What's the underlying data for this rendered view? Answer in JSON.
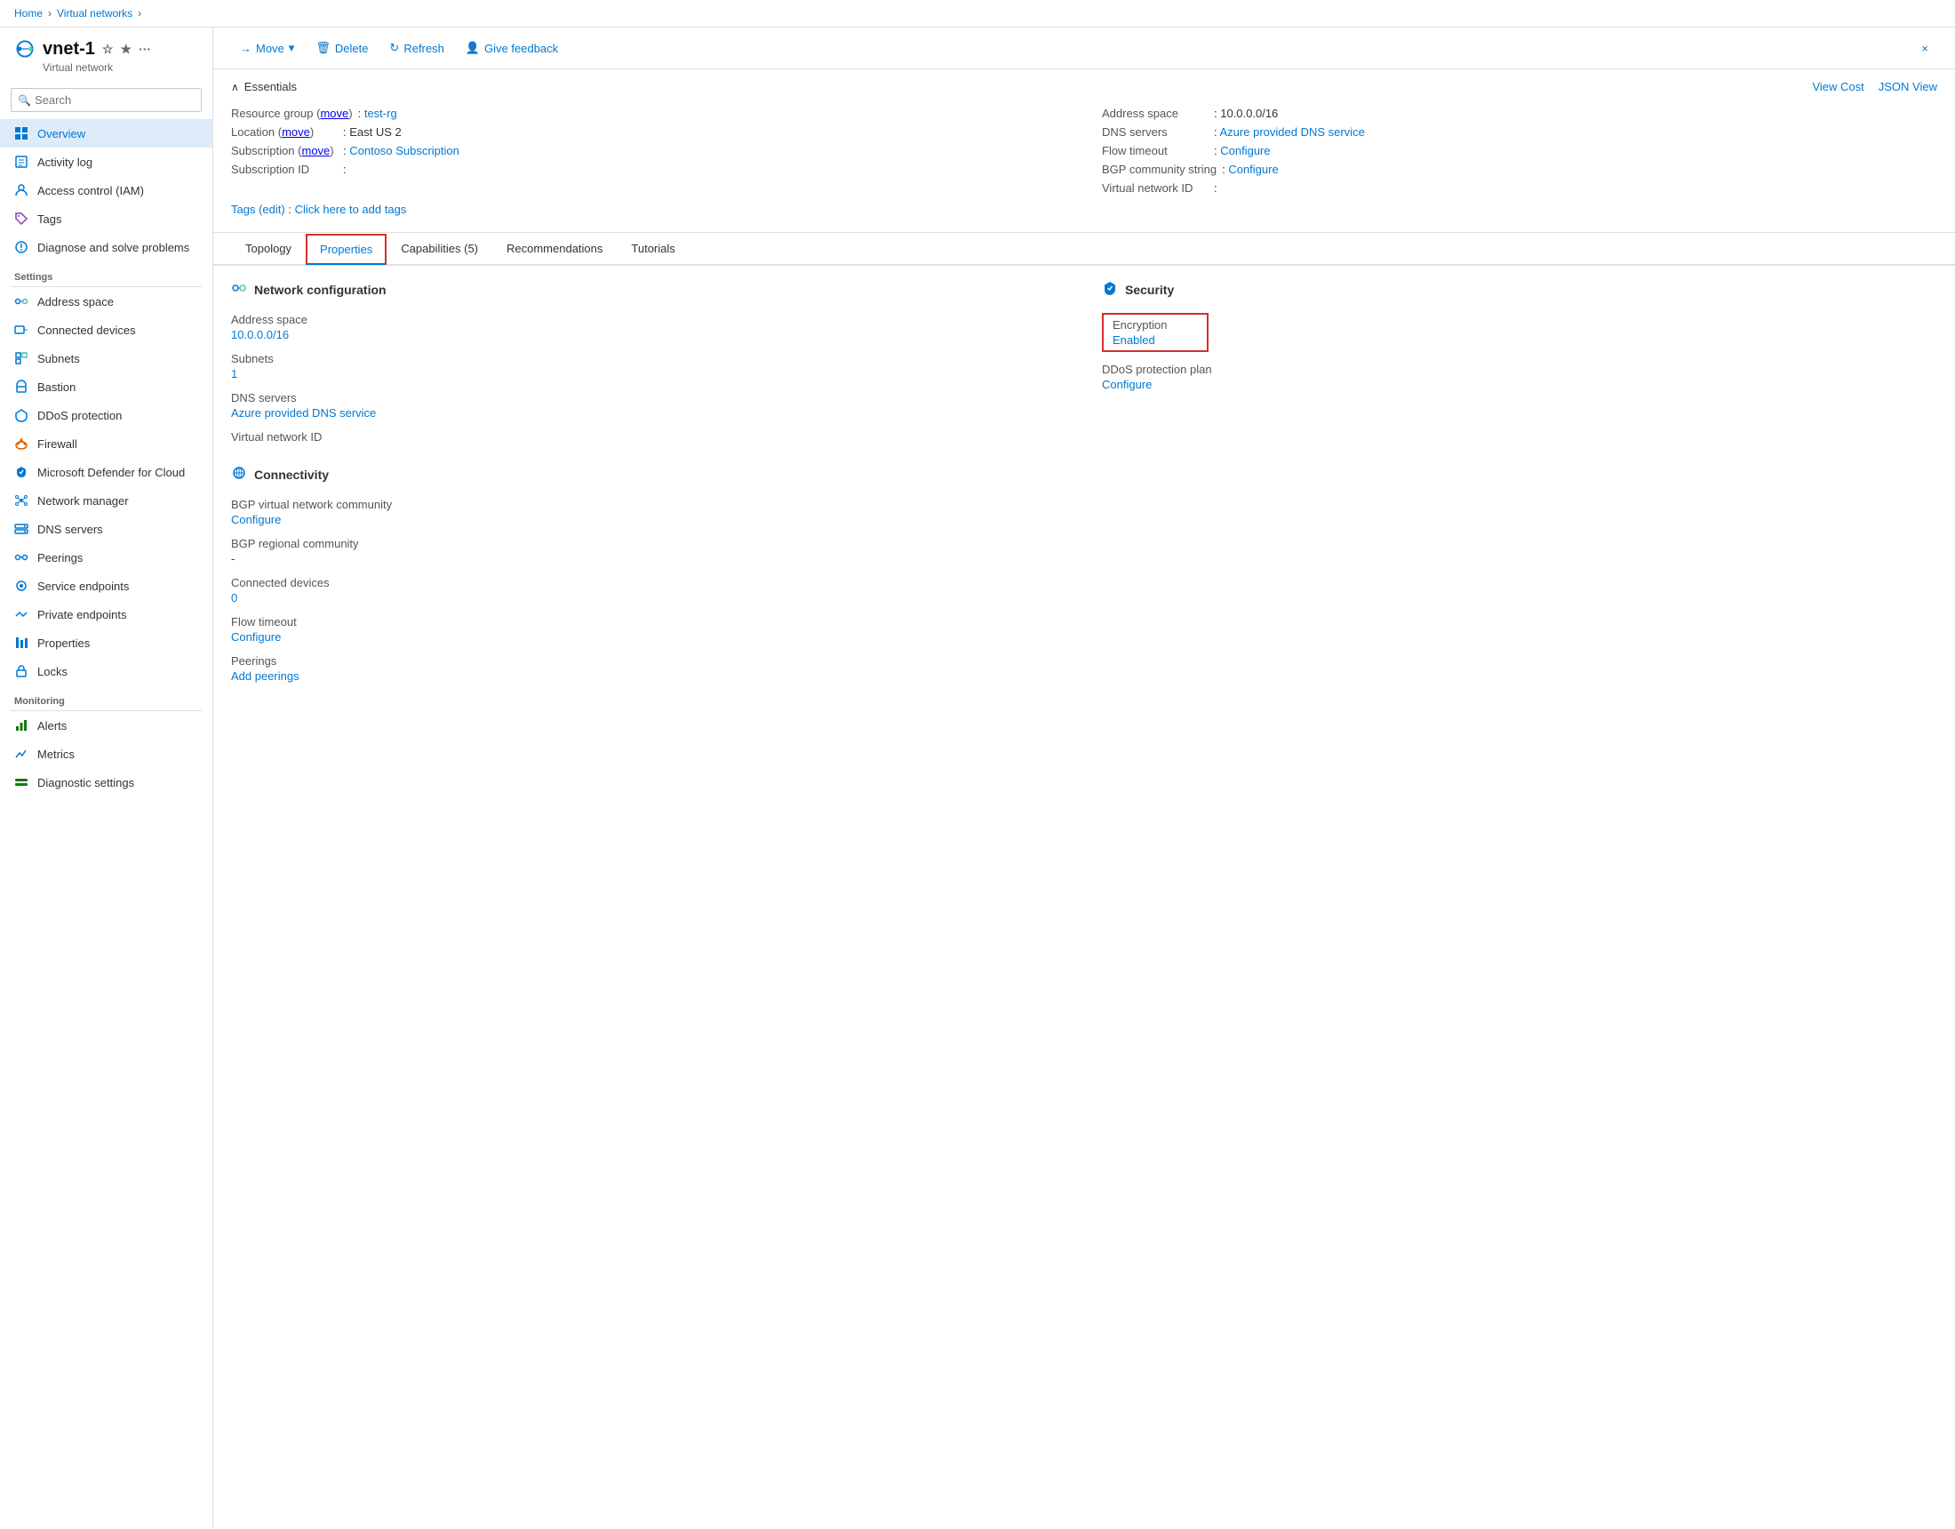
{
  "breadcrumb": {
    "home": "Home",
    "section": "Virtual networks",
    "sep": ">"
  },
  "resource": {
    "name": "vnet-1",
    "type": "Virtual network"
  },
  "sidebar": {
    "search_placeholder": "Search",
    "collapse_label": "<<",
    "nav_items": [
      {
        "id": "overview",
        "label": "Overview",
        "active": true,
        "section": null
      },
      {
        "id": "activity-log",
        "label": "Activity log",
        "section": null
      },
      {
        "id": "access-control",
        "label": "Access control (IAM)",
        "section": null
      },
      {
        "id": "tags",
        "label": "Tags",
        "section": null
      },
      {
        "id": "diagnose",
        "label": "Diagnose and solve problems",
        "section": null
      },
      {
        "id": "settings-label",
        "label": "Settings",
        "section": "divider"
      },
      {
        "id": "address-space",
        "label": "Address space",
        "section": "settings"
      },
      {
        "id": "connected-devices",
        "label": "Connected devices",
        "section": "settings"
      },
      {
        "id": "subnets",
        "label": "Subnets",
        "section": "settings"
      },
      {
        "id": "bastion",
        "label": "Bastion",
        "section": "settings"
      },
      {
        "id": "ddos-protection",
        "label": "DDoS protection",
        "section": "settings"
      },
      {
        "id": "firewall",
        "label": "Firewall",
        "section": "settings"
      },
      {
        "id": "ms-defender",
        "label": "Microsoft Defender for Cloud",
        "section": "settings"
      },
      {
        "id": "network-manager",
        "label": "Network manager",
        "section": "settings"
      },
      {
        "id": "dns-servers",
        "label": "DNS servers",
        "section": "settings"
      },
      {
        "id": "peerings",
        "label": "Peerings",
        "section": "settings"
      },
      {
        "id": "service-endpoints",
        "label": "Service endpoints",
        "section": "settings"
      },
      {
        "id": "private-endpoints",
        "label": "Private endpoints",
        "section": "settings"
      },
      {
        "id": "properties",
        "label": "Properties",
        "section": "settings"
      },
      {
        "id": "locks",
        "label": "Locks",
        "section": "settings"
      },
      {
        "id": "monitoring-label",
        "label": "Monitoring",
        "section": "divider"
      },
      {
        "id": "alerts",
        "label": "Alerts",
        "section": "monitoring"
      },
      {
        "id": "metrics",
        "label": "Metrics",
        "section": "monitoring"
      },
      {
        "id": "diagnostic-settings",
        "label": "Diagnostic settings",
        "section": "monitoring"
      }
    ]
  },
  "toolbar": {
    "move_label": "Move",
    "delete_label": "Delete",
    "refresh_label": "Refresh",
    "feedback_label": "Give feedback",
    "close_label": "×"
  },
  "essentials": {
    "header": "Essentials",
    "view_cost": "View Cost",
    "json_view": "JSON View",
    "fields_left": [
      {
        "label": "Resource group (move)",
        "value": "test-rg",
        "link": true
      },
      {
        "label": "Location (move)",
        "value": "East US 2",
        "link": false
      },
      {
        "label": "Subscription (move)",
        "value": "Contoso Subscription",
        "link": true
      },
      {
        "label": "Subscription ID",
        "value": "",
        "link": false
      }
    ],
    "fields_right": [
      {
        "label": "Address space",
        "value": "10.0.0.0/16",
        "link": false
      },
      {
        "label": "DNS servers",
        "value": "Azure provided DNS service",
        "link": true
      },
      {
        "label": "Flow timeout",
        "value": "Configure",
        "link": true
      },
      {
        "label": "BGP community string",
        "value": "Configure",
        "link": true
      },
      {
        "label": "Virtual network ID",
        "value": "",
        "link": false
      }
    ],
    "tags_label": "Tags (edit)",
    "tags_action": "Click here to add tags"
  },
  "tabs": [
    {
      "id": "topology",
      "label": "Topology",
      "active": false,
      "bordered": false
    },
    {
      "id": "properties",
      "label": "Properties",
      "active": true,
      "bordered": true
    },
    {
      "id": "capabilities",
      "label": "Capabilities (5)",
      "active": false,
      "bordered": false
    },
    {
      "id": "recommendations",
      "label": "Recommendations",
      "active": false,
      "bordered": false
    },
    {
      "id": "tutorials",
      "label": "Tutorials",
      "active": false,
      "bordered": false
    }
  ],
  "properties": {
    "network_config": {
      "section_title": "Network configuration",
      "fields": [
        {
          "label": "Address space",
          "value": "10.0.0.0/16",
          "link": true
        },
        {
          "label": "Subnets",
          "value": "1",
          "link": true
        },
        {
          "label": "DNS servers",
          "value": "Azure provided DNS service",
          "link": true
        },
        {
          "label": "Virtual network ID",
          "value": "",
          "link": false
        }
      ]
    },
    "security": {
      "section_title": "Security",
      "encryption_label": "Encryption",
      "encryption_value": "Enabled",
      "ddos_label": "DDoS protection plan",
      "ddos_value": "Configure",
      "ddos_link": true
    },
    "connectivity": {
      "section_title": "Connectivity",
      "fields": [
        {
          "label": "BGP virtual network community",
          "value": "Configure",
          "link": true
        },
        {
          "label": "BGP regional community",
          "value": "-",
          "link": false
        },
        {
          "label": "Connected devices",
          "value": "0",
          "link": true
        },
        {
          "label": "Flow timeout",
          "value": "Configure",
          "link": true
        },
        {
          "label": "Peerings",
          "value": "Add peerings",
          "link": true
        }
      ]
    }
  }
}
